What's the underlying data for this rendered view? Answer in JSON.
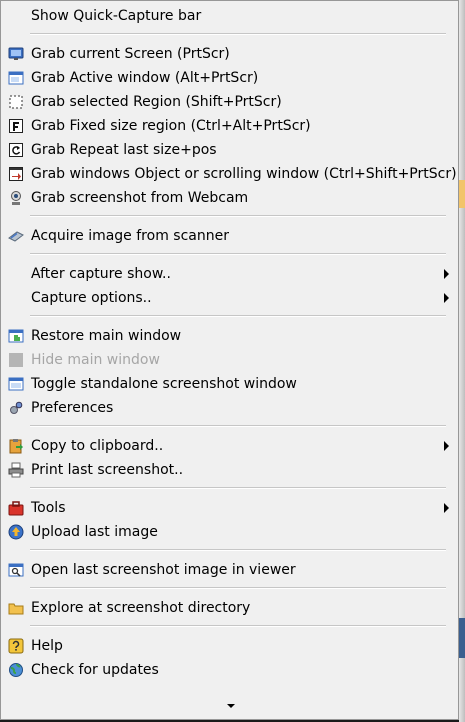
{
  "menu": {
    "items": [
      {
        "label": "Show Quick-Capture bar",
        "icon": "none"
      },
      {
        "label": "Grab current Screen (PrtScr)",
        "icon": "monitor-icon"
      },
      {
        "label": "Grab Active window (Alt+PrtScr)",
        "icon": "window-icon"
      },
      {
        "label": "Grab selected Region (Shift+PrtScr)",
        "icon": "dashed-region-icon"
      },
      {
        "label": "Grab Fixed size region (Ctrl+Alt+PrtScr)",
        "icon": "fixed-size-icon"
      },
      {
        "label": "Grab Repeat last size+pos",
        "icon": "repeat-icon"
      },
      {
        "label": "Grab windows Object or scrolling window (Ctrl+Shift+PrtScr)",
        "icon": "object-window-icon"
      },
      {
        "label": "Grab screenshot from Webcam",
        "icon": "webcam-icon"
      },
      {
        "label": "Acquire image from scanner",
        "icon": "scanner-icon"
      },
      {
        "label": "After capture show..",
        "icon": "none"
      },
      {
        "label": "Capture options..",
        "icon": "none"
      },
      {
        "label": "Restore main window",
        "icon": "restore-window-icon"
      },
      {
        "label": "Hide main window",
        "icon": "hide-window-icon"
      },
      {
        "label": "Toggle standalone screenshot window",
        "icon": "standalone-window-icon"
      },
      {
        "label": "Preferences",
        "icon": "preferences-icon"
      },
      {
        "label": "Copy to clipboard..",
        "icon": "clipboard-icon"
      },
      {
        "label": "Print last screenshot..",
        "icon": "printer-icon"
      },
      {
        "label": "Tools",
        "icon": "toolbox-icon"
      },
      {
        "label": "Upload last image",
        "icon": "upload-icon"
      },
      {
        "label": "Open last screenshot image in viewer",
        "icon": "viewer-icon"
      },
      {
        "label": "Explore at screenshot directory",
        "icon": "folder-icon"
      },
      {
        "label": "Help",
        "icon": "help-icon"
      },
      {
        "label": "Check for updates",
        "icon": "update-globe-icon"
      }
    ],
    "more_indicator": "scroll-down-arrow-icon"
  },
  "colors": {
    "menu_background": "#f0f0f0",
    "text": "#000000",
    "disabled_text": "#a6a6a6",
    "separator": "#c6c6c6"
  }
}
